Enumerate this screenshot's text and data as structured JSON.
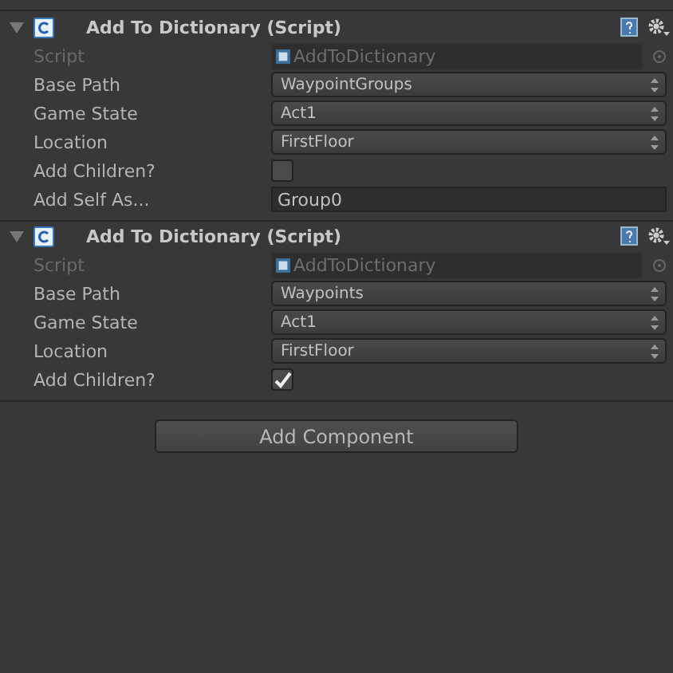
{
  "components": [
    {
      "title": "Add To Dictionary (Script)",
      "expanded": true,
      "fields": [
        {
          "kind": "object",
          "label": "Script",
          "value": "AddToDictionary",
          "disabled": true
        },
        {
          "kind": "popup",
          "label": "Base Path",
          "value": "WaypointGroups",
          "disabled": false
        },
        {
          "kind": "popup",
          "label": "Game State",
          "value": "Act1",
          "disabled": false
        },
        {
          "kind": "popup",
          "label": "Location",
          "value": "FirstFloor",
          "disabled": false
        },
        {
          "kind": "checkbox",
          "label": "Add Children?",
          "checked": false,
          "disabled": false
        },
        {
          "kind": "text",
          "label": "Add Self As...",
          "value": "Group0",
          "disabled": false
        }
      ]
    },
    {
      "title": "Add To Dictionary (Script)",
      "expanded": true,
      "fields": [
        {
          "kind": "object",
          "label": "Script",
          "value": "AddToDictionary",
          "disabled": true
        },
        {
          "kind": "popup",
          "label": "Base Path",
          "value": "Waypoints",
          "disabled": false
        },
        {
          "kind": "popup",
          "label": "Game State",
          "value": "Act1",
          "disabled": false
        },
        {
          "kind": "popup",
          "label": "Location",
          "value": "FirstFloor",
          "disabled": false
        },
        {
          "kind": "checkbox",
          "label": "Add Children?",
          "checked": true,
          "disabled": false
        }
      ]
    }
  ],
  "add_button": "Add Component"
}
